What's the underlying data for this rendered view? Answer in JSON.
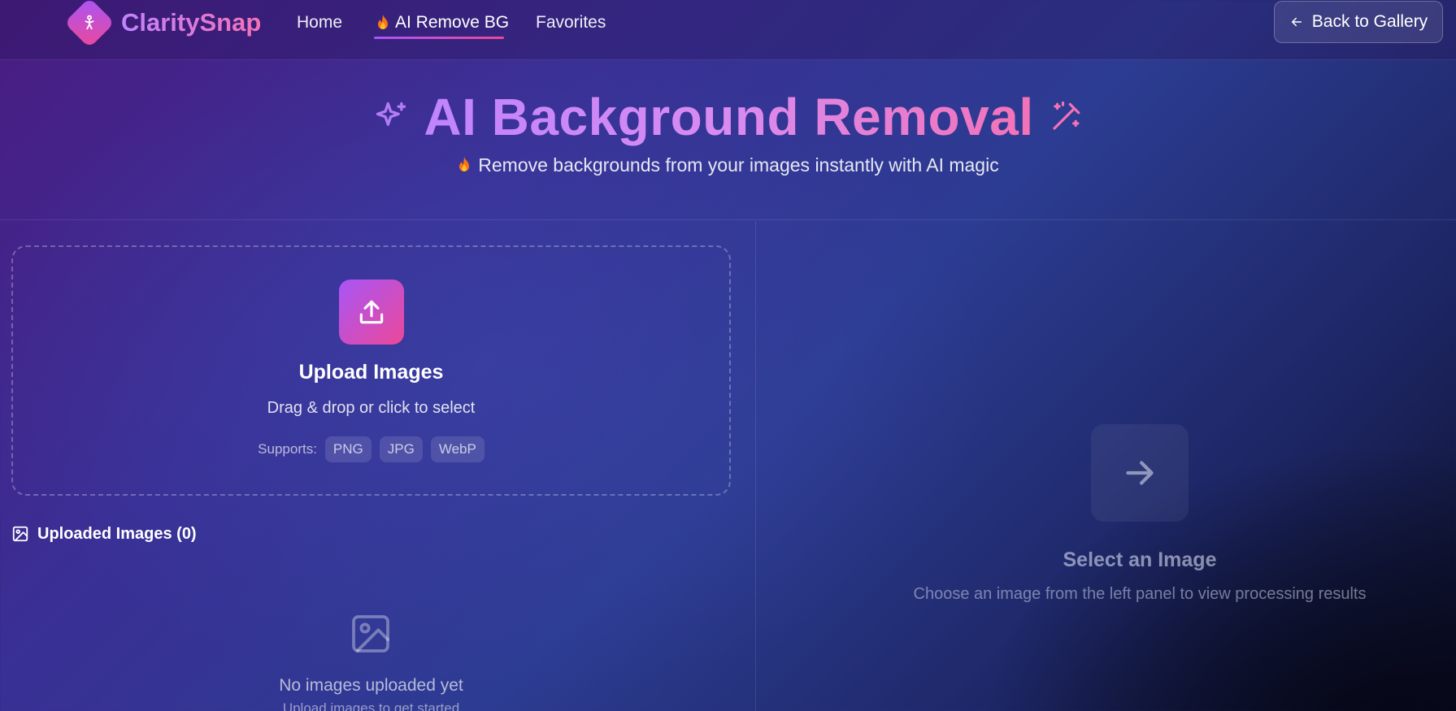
{
  "nav": {
    "brand": "ClaritySnap",
    "logo_icon": "magic-person-icon",
    "links": [
      {
        "label": "Home"
      },
      {
        "label": "AI Remove BG",
        "icon": "fire-icon",
        "active": true
      },
      {
        "label": "Favorites"
      }
    ],
    "back_label": "Back to Gallery",
    "back_icon": "arrow-left-icon"
  },
  "hero": {
    "title": "AI Background Removal",
    "subtitle": "Remove backgrounds from your images instantly with AI magic",
    "left_icon": "sparkles-icon",
    "right_icon": "magic-wand-icon"
  },
  "upload": {
    "title": "Upload Images",
    "subtitle": "Drag & drop or click to select",
    "supports_label": "Supports:",
    "formats": [
      "PNG",
      "JPG",
      "WebP"
    ]
  },
  "uploaded": {
    "header": "Uploaded Images (0)",
    "empty_title": "No images uploaded yet",
    "empty_subtitle": "Upload images to get started"
  },
  "result": {
    "title": "Select an Image",
    "subtitle": "Choose an image from the left panel to view processing results"
  },
  "colors": {
    "accent_from": "#a855f7",
    "accent_to": "#ec4899",
    "fire": "#f97316"
  }
}
